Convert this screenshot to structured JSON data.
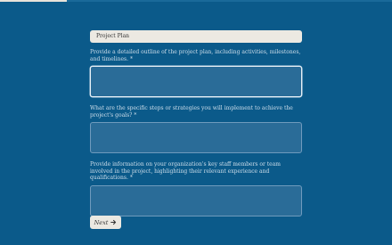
{
  "progress": {
    "fraction": 0.17
  },
  "section": {
    "title": "Project Plan"
  },
  "questions": [
    {
      "label": "Provide a detailed outline of the project plan, including activities, milestones, and timelines.",
      "required_mark": "*",
      "value": "",
      "focused": true
    },
    {
      "label": "What are the specific steps or strategies you will implement to achieve the project's goals?",
      "required_mark": "*",
      "value": "",
      "focused": false
    },
    {
      "label": "Provide information on your organization's key staff members or team involved in the project, highlighting their relevant experience and qualifications.",
      "required_mark": "*",
      "value": "",
      "focused": false
    }
  ],
  "next_button": {
    "label": "Next",
    "icon": "arrow-right-icon"
  },
  "colors": {
    "background": "#0b5a8a",
    "input_bg": "#2a6c98",
    "header_bg": "#ece9e2",
    "progress_fill": "#e8e3da"
  }
}
